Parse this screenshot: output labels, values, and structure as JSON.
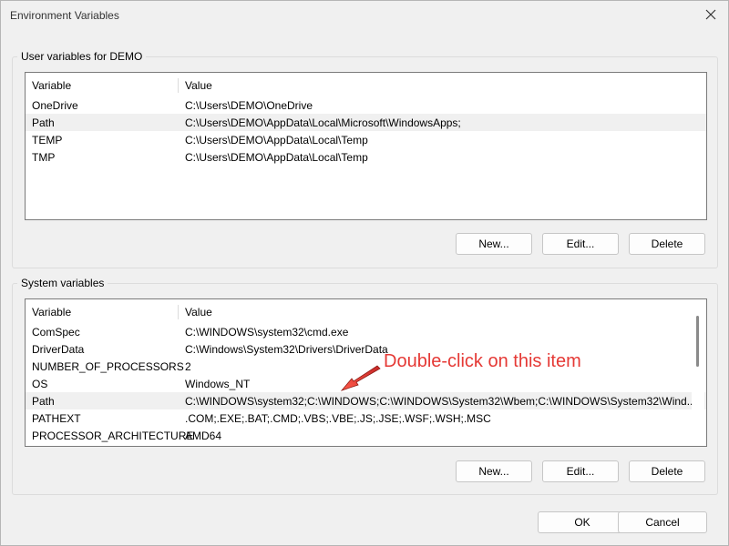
{
  "window": {
    "title": "Environment Variables",
    "close_icon": "close-icon"
  },
  "user_vars": {
    "group_label": "User variables for DEMO",
    "columns": {
      "variable": "Variable",
      "value": "Value"
    },
    "rows": [
      {
        "name": "OneDrive",
        "value": "C:\\Users\\DEMO\\OneDrive"
      },
      {
        "name": "Path",
        "value": "C:\\Users\\DEMO\\AppData\\Local\\Microsoft\\WindowsApps;"
      },
      {
        "name": "TEMP",
        "value": "C:\\Users\\DEMO\\AppData\\Local\\Temp"
      },
      {
        "name": "TMP",
        "value": "C:\\Users\\DEMO\\AppData\\Local\\Temp"
      }
    ],
    "buttons": {
      "new": "New...",
      "edit": "Edit...",
      "delete": "Delete"
    }
  },
  "system_vars": {
    "group_label": "System variables",
    "columns": {
      "variable": "Variable",
      "value": "Value"
    },
    "rows": [
      {
        "name": "ComSpec",
        "value": "C:\\WINDOWS\\system32\\cmd.exe"
      },
      {
        "name": "DriverData",
        "value": "C:\\Windows\\System32\\Drivers\\DriverData"
      },
      {
        "name": "NUMBER_OF_PROCESSORS",
        "value": "2"
      },
      {
        "name": "OS",
        "value": "Windows_NT"
      },
      {
        "name": "Path",
        "value": "C:\\WINDOWS\\system32;C:\\WINDOWS;C:\\WINDOWS\\System32\\Wbem;C:\\WINDOWS\\System32\\Wind..."
      },
      {
        "name": "PATHEXT",
        "value": ".COM;.EXE;.BAT;.CMD;.VBS;.VBE;.JS;.JSE;.WSF;.WSH;.MSC"
      },
      {
        "name": "PROCESSOR_ARCHITECTURE",
        "value": "AMD64"
      }
    ],
    "buttons": {
      "new": "New...",
      "edit": "Edit...",
      "delete": "Delete"
    }
  },
  "footer": {
    "ok": "OK",
    "cancel": "Cancel"
  },
  "annotation": {
    "text": "Double-click on this item",
    "color": "#e53935"
  }
}
